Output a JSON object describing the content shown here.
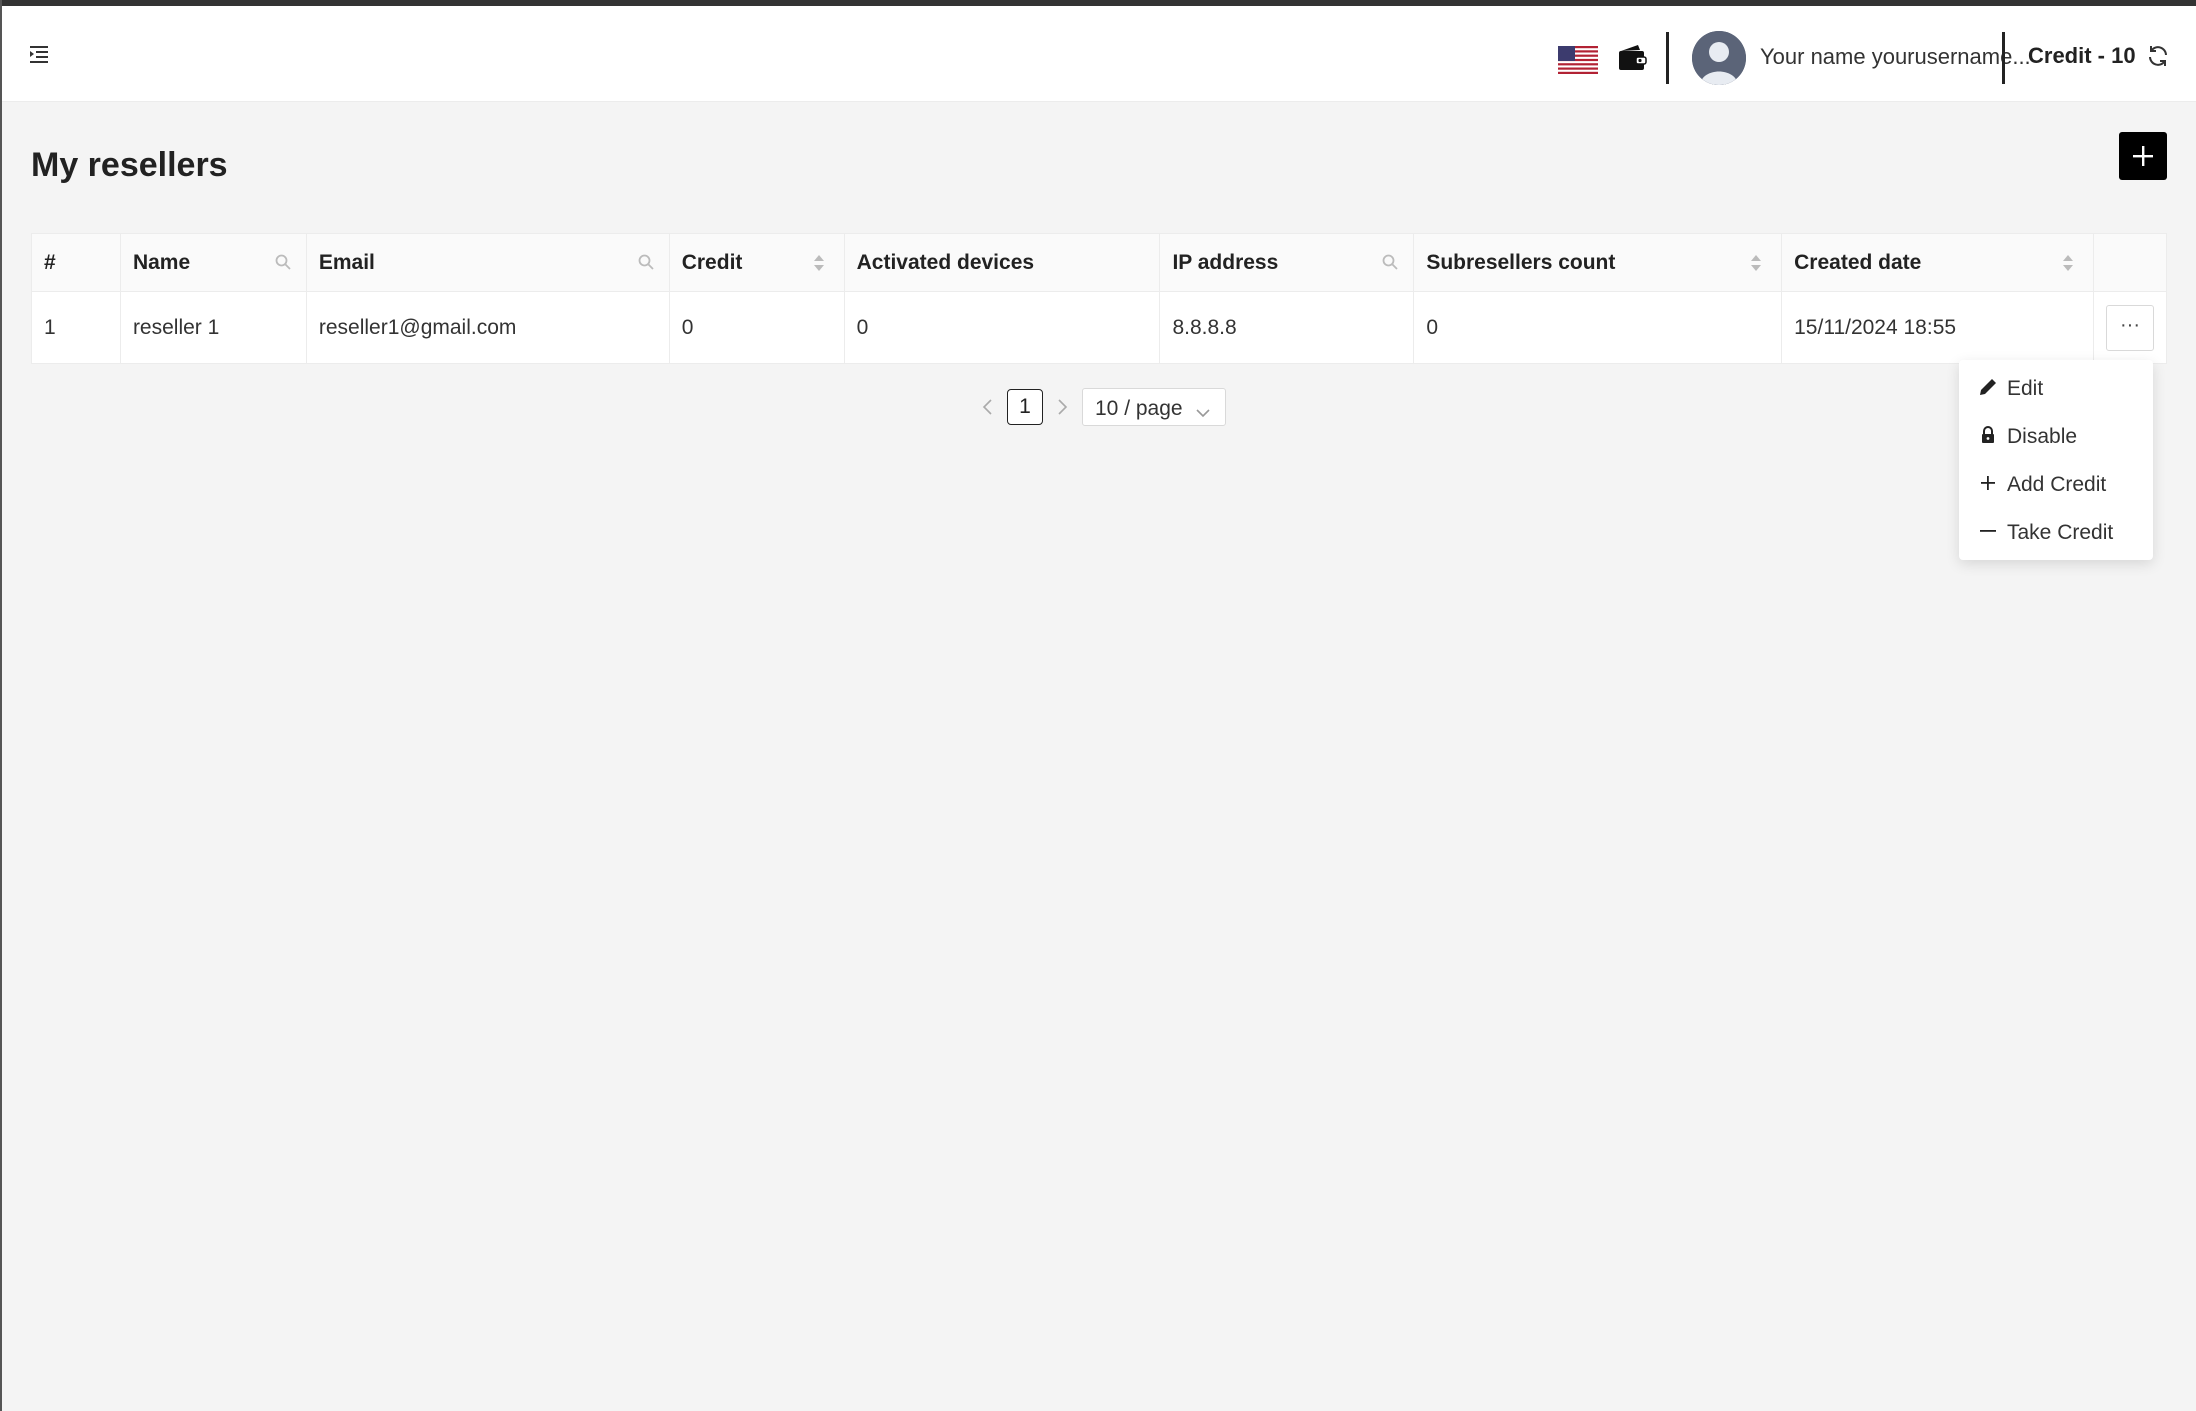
{
  "header": {
    "menu_icon": "menu-fold-icon",
    "language_icon": "us-flag-icon",
    "wallet_icon": "wallet-icon",
    "avatar_icon": "user-avatar-icon",
    "username": "Your name yourusername...",
    "credit_label": "Credit - 10",
    "refresh_icon": "refresh-icon"
  },
  "page": {
    "title": "My resellers",
    "add_icon": "plus-icon"
  },
  "table": {
    "columns": [
      {
        "label": "#",
        "icon": null
      },
      {
        "label": "Name",
        "icon": "search-icon"
      },
      {
        "label": "Email",
        "icon": "search-icon"
      },
      {
        "label": "Credit",
        "icon": "sort-icon"
      },
      {
        "label": "Activated devices",
        "icon": null
      },
      {
        "label": "IP address",
        "icon": "search-icon"
      },
      {
        "label": "Subresellers count",
        "icon": "sort-icon"
      },
      {
        "label": "Created date",
        "icon": "sort-icon"
      },
      {
        "label": "",
        "icon": null
      }
    ],
    "rows": [
      {
        "index": "1",
        "name": "reseller 1",
        "email": "reseller1@gmail.com",
        "credit": "0",
        "activated_devices": "0",
        "ip_address": "8.8.8.8",
        "subresellers_count": "0",
        "created_date": "15/11/2024 18:55",
        "actions_label": "···"
      }
    ]
  },
  "pagination": {
    "current_page": "1",
    "page_size": "10 / page"
  },
  "actions_menu": {
    "items": [
      {
        "label": "Edit",
        "icon": "edit-pencil-icon"
      },
      {
        "label": "Disable",
        "icon": "lock-icon"
      },
      {
        "label": "Add Credit",
        "icon": "plus-icon"
      },
      {
        "label": "Take Credit",
        "icon": "minus-icon"
      }
    ]
  },
  "colors": {
    "accent": "#000000",
    "background": "#f4f4f4",
    "header_bg": "#ffffff"
  }
}
